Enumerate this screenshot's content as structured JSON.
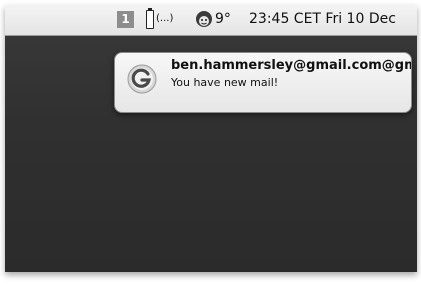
{
  "menubar": {
    "space_number": "1",
    "battery_text": "(...)",
    "weather_icon": "weather-face-icon",
    "temperature": "9°",
    "clock": "23:45 CET Fri 10 Dec"
  },
  "notification": {
    "icon": "gmail-notifier-icon",
    "title": "ben.hammersley@gmail.com@gmail.com",
    "message": "You have new mail!"
  }
}
